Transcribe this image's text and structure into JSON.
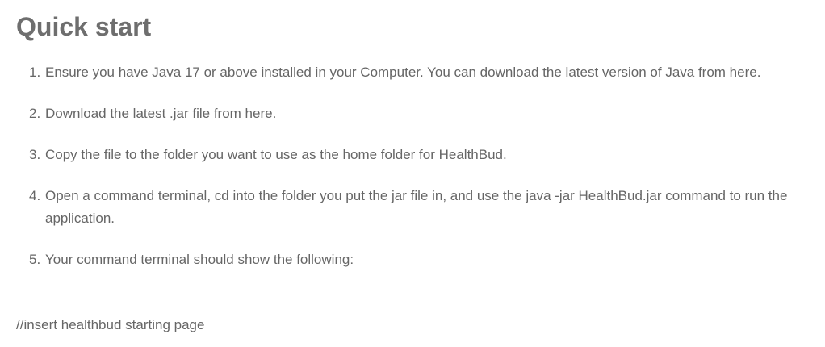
{
  "page": {
    "heading": "Quick start",
    "steps": [
      {
        "number": "1.",
        "text": "Ensure you have Java 17 or above installed in your Computer. You can download the latest version of Java from here."
      },
      {
        "number": "2.",
        "text": "Download the latest .jar file from here."
      },
      {
        "number": "3.",
        "text": "Copy the file to the folder you want to use as the home folder for HealthBud."
      },
      {
        "number": "4.",
        "text": "Open a command terminal, cd into the folder you put the jar file in, and use the java -jar HealthBud.jar command to run the application."
      },
      {
        "number": "5.",
        "text": "Your command terminal should show the following:"
      }
    ],
    "note": "//insert healthbud starting page"
  }
}
